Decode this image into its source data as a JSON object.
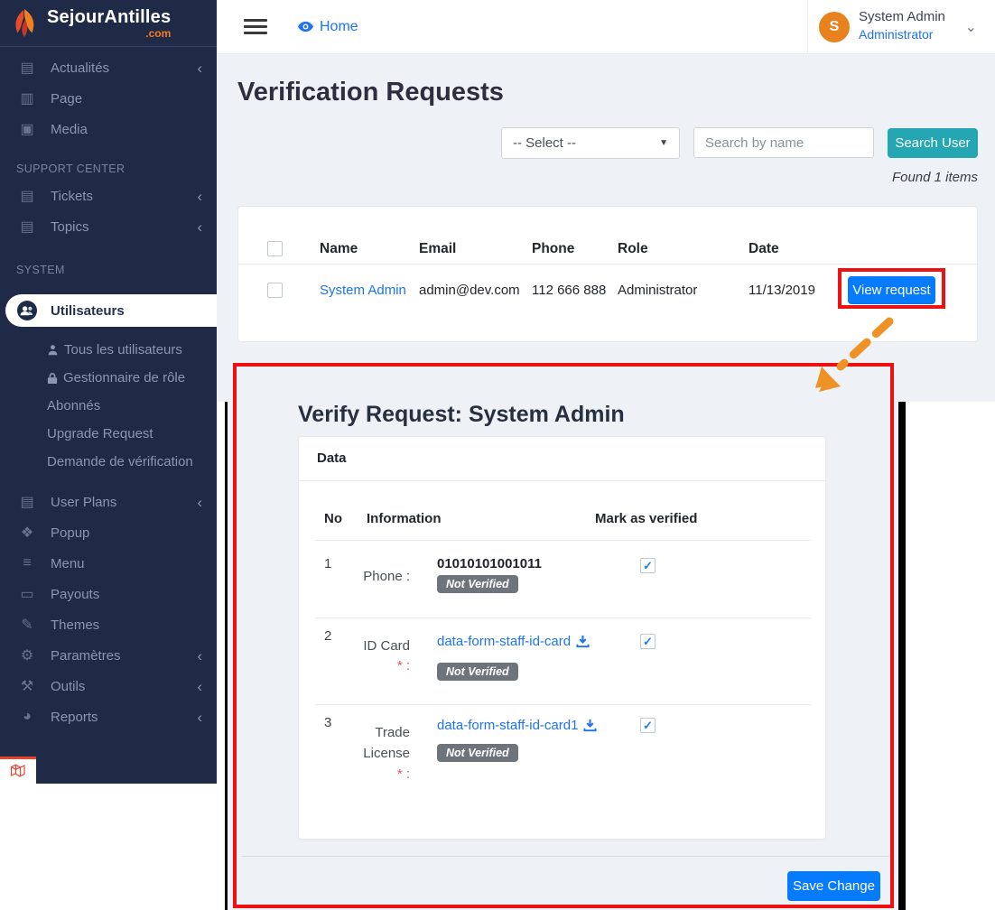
{
  "brand": {
    "name": "SejourAntilles",
    "tld": ".com"
  },
  "colors": {
    "sidebar_bg": "#1f2b46",
    "accent_teal": "#24a6b3",
    "primary_blue": "#067bfe",
    "link_blue": "#1d73f2",
    "annotation_red": "#ee1111",
    "annotation_orange": "#ef9226",
    "badge_gray": "#6e747b",
    "avatar_orange": "#e8821e"
  },
  "glyphs": {
    "chevron_left": "‹",
    "chevron_down": "⌄",
    "select_arrow": "▼",
    "check": "✓",
    "icon_actualites": "▤",
    "icon_page": "▥",
    "icon_media": "▣",
    "icon_tickets": "▤",
    "icon_topics": "▤",
    "icon_user_plans": "▤",
    "icon_popup": "❖",
    "icon_menu": "≡",
    "icon_payouts": "▭",
    "icon_themes": "✎",
    "icon_parametres": "⚙",
    "icon_outils": "⚒",
    "icon_reports": "◕"
  },
  "sidebar": {
    "sections": {
      "support": "SUPPORT CENTER",
      "system": "SYSTEM"
    },
    "items": {
      "actualites": "Actualités",
      "page": "Page",
      "media": "Media",
      "tickets": "Tickets",
      "topics": "Topics",
      "utilisateurs": "Utilisateurs",
      "user_plans": "User Plans",
      "popup": "Popup",
      "menu": "Menu",
      "payouts": "Payouts",
      "themes": "Themes",
      "parametres": "Paramètres",
      "outils": "Outils",
      "reports": "Reports"
    },
    "submenu": {
      "tous": "Tous les utilisateurs",
      "gestionnaire": "Gestionnaire de rôle",
      "abonnes": "Abonnés",
      "upgrade": "Upgrade Request",
      "demande": "Demande de vérification"
    }
  },
  "topbar": {
    "home": "Home",
    "user_name": "System Admin",
    "user_role": "Administrator",
    "avatar_initial": "S"
  },
  "page": {
    "title": "Verification Requests",
    "found": "Found 1 items"
  },
  "filters": {
    "select_value": "-- Select --",
    "search_placeholder": "Search by name",
    "search_button": "Search User"
  },
  "table": {
    "headers": {
      "name": "Name",
      "email": "Email",
      "phone": "Phone",
      "role": "Role",
      "date": "Date"
    },
    "row": {
      "name": "System Admin",
      "email": "admin@dev.com",
      "phone": "112 666 888",
      "role": "Administrator",
      "date": "11/13/2019",
      "action": "View request"
    }
  },
  "modal": {
    "title": "Verify Request: System Admin",
    "card_header": "Data",
    "columns": {
      "no": "No",
      "information": "Information",
      "verified": "Mark as verified"
    },
    "rows": {
      "phone": {
        "no": "1",
        "label": "Phone :",
        "value": "01010101001011",
        "badge": "Not Verified"
      },
      "id_card": {
        "no": "2",
        "label": "ID Card",
        "required": "* :",
        "link": "data-form-staff-id-card",
        "badge": "Not Verified"
      },
      "trade": {
        "no": "3",
        "label_line1": "Trade",
        "label_line2": "License",
        "required": "* :",
        "link": "data-form-staff-id-card1",
        "badge": "Not Verified"
      }
    },
    "save_button": "Save Change"
  }
}
